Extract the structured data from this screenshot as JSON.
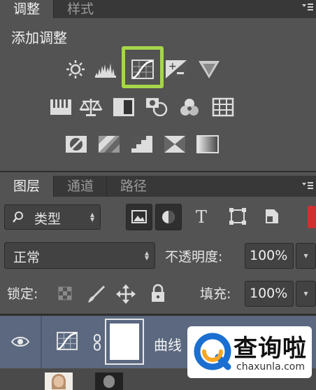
{
  "adjust_panel": {
    "tabs": [
      {
        "label": "调整",
        "active": true
      },
      {
        "label": "样式",
        "active": false
      }
    ],
    "title": "添加调整",
    "rows": [
      [
        "brightness-contrast-icon",
        "levels-icon",
        "curves-icon",
        "exposure-icon",
        "vibrance-icon"
      ],
      [
        "hue-saturation-icon",
        "color-balance-icon",
        "black-white-icon",
        "photo-filter-icon",
        "channel-mixer-icon",
        "color-lookup-icon"
      ],
      [
        "invert-icon",
        "posterize-icon",
        "threshold-icon",
        "selective-color-icon",
        "gradient-map-icon"
      ]
    ],
    "highlighted_icon": "curves-icon",
    "highlight_color": "#a6d64a"
  },
  "layers_panel": {
    "tabs": [
      {
        "label": "图层",
        "active": true
      },
      {
        "label": "通道",
        "active": false
      },
      {
        "label": "路径",
        "active": false
      }
    ],
    "filter": {
      "kind_label": "类型",
      "icons": [
        "pixel-filter-icon",
        "adjustment-filter-icon",
        "type-filter-icon",
        "shape-filter-icon",
        "smart-object-filter-icon"
      ]
    },
    "blend_mode": "正常",
    "opacity_label": "不透明度:",
    "opacity_value": "100%",
    "lock_label": "锁定:",
    "fill_label": "填充:",
    "fill_value": "100%",
    "layers": [
      {
        "name": "曲线",
        "type": "curves-adjustment",
        "selected": true,
        "visible": true
      },
      {
        "name": "",
        "type": "photo",
        "selected": false,
        "visible": true
      }
    ]
  },
  "watermark": {
    "text": "查询啦",
    "url": "chaxunla.com"
  }
}
